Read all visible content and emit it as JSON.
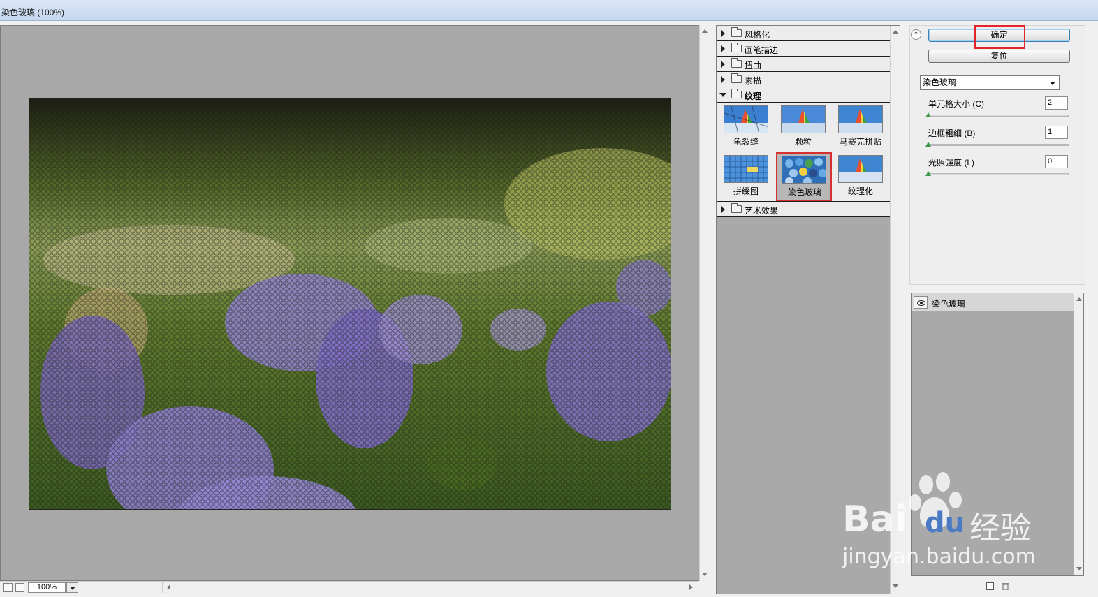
{
  "window": {
    "title": "染色玻璃 (100%)"
  },
  "preview": {
    "zoom": "100%"
  },
  "gallery": {
    "categories_before": [
      {
        "label": "风格化"
      },
      {
        "label": "画笔描边"
      },
      {
        "label": "扭曲"
      },
      {
        "label": "素描"
      }
    ],
    "open_category": {
      "label": "纹理"
    },
    "filters": [
      {
        "label": "龟裂缝"
      },
      {
        "label": "颗粒"
      },
      {
        "label": "马赛克拼贴"
      },
      {
        "label": "拼缀图"
      },
      {
        "label": "染色玻璃",
        "selected": true
      },
      {
        "label": "纹理化"
      }
    ],
    "categories_after": [
      {
        "label": "艺术效果"
      }
    ]
  },
  "settings": {
    "ok_label": "确定",
    "reset_label": "复位",
    "filter_select": "染色玻璃",
    "params": [
      {
        "label": "单元格大小 (C)",
        "value": "2"
      },
      {
        "label": "边框粗细 (B)",
        "value": "1"
      },
      {
        "label": "光照强度 (L)",
        "value": "0"
      }
    ]
  },
  "layers": {
    "items": [
      {
        "label": "染色玻璃"
      }
    ]
  },
  "watermark": {
    "brand": "Bai",
    "brand2": "du",
    "cn": "经验",
    "url": "jingyan.baidu.com"
  },
  "colors": {
    "accent_highlight": "#e0262a",
    "panel_gray": "#a9a9a9"
  }
}
